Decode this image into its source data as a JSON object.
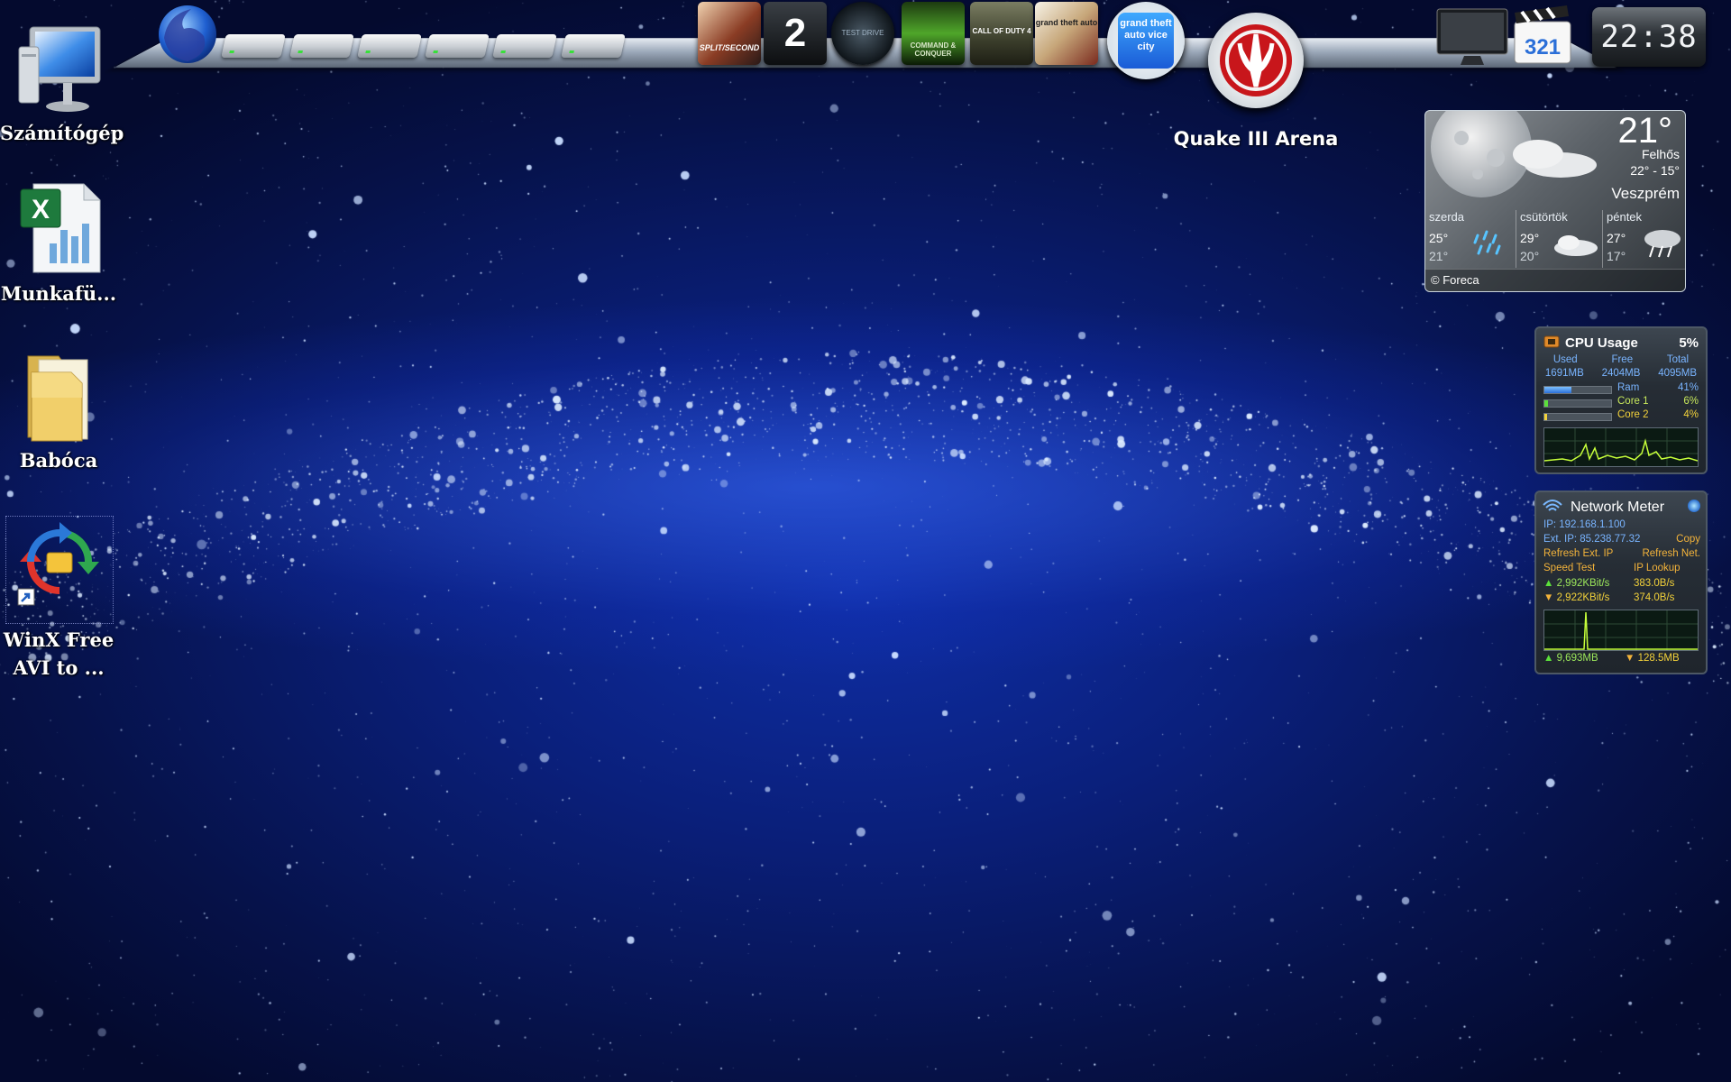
{
  "desktop_icons": [
    {
      "label": "Számítógép"
    },
    {
      "label": "Munkafü..."
    },
    {
      "label": "Babóca"
    },
    {
      "label": "WinX Free\nAVI to ..."
    }
  ],
  "dock": {
    "hovered_label": "Quake III Arena",
    "items": [
      {
        "icon": "firefox-icon"
      },
      {
        "icon": "drive-icon"
      },
      {
        "icon": "drive-icon"
      },
      {
        "icon": "drive-icon"
      },
      {
        "icon": "drive-icon"
      },
      {
        "icon": "drive-icon"
      },
      {
        "icon": "drive-icon"
      },
      {
        "icon": "split-second-icon",
        "text": "SPLIT/SECOND"
      },
      {
        "icon": "portal-2-icon",
        "text": "2"
      },
      {
        "icon": "test-drive-icon",
        "text": "TEST DRIVE"
      },
      {
        "icon": "command-and-conquer-icon",
        "text": "COMMAND & CONQUER"
      },
      {
        "icon": "call-of-duty-4-icon",
        "text": "CALL OF DUTY 4"
      },
      {
        "icon": "gta-san-andreas-icon",
        "text": "grand theft auto"
      },
      {
        "icon": "gta-vice-city-icon",
        "text": "grand theft auto vice city"
      },
      {
        "icon": "quake-3-icon"
      },
      {
        "icon": "monitor-icon"
      },
      {
        "icon": "clapper-321-icon",
        "text": "321"
      }
    ],
    "clock": "22:38"
  },
  "weather": {
    "temp": "21°",
    "condition": "Felhős",
    "range": "22° - 15°",
    "city": "Veszprém",
    "days": [
      {
        "name": "szerda",
        "high": "25°",
        "low": "21°",
        "icon": "rain-icon"
      },
      {
        "name": "csütörtök",
        "high": "29°",
        "low": "20°",
        "icon": "cloud-icon"
      },
      {
        "name": "péntek",
        "high": "27°",
        "low": "17°",
        "icon": "storm-icon"
      }
    ],
    "credit": "© Foreca"
  },
  "cpu": {
    "title": "CPU Usage",
    "percent": "5%",
    "headers": [
      "Used",
      "Free",
      "Total"
    ],
    "values": [
      "1691MB",
      "2404MB",
      "4095MB"
    ],
    "rows": [
      {
        "label": "Ram",
        "value": "41%",
        "fill": 0.41
      },
      {
        "label": "Core 1",
        "value": "6%",
        "fill": 0.06
      },
      {
        "label": "Core 2",
        "value": "4%",
        "fill": 0.04
      }
    ]
  },
  "net": {
    "title": "Network Meter",
    "ip": "IP: 192.168.1.100",
    "ext_ip": "Ext. IP: 85.238.77.32",
    "copy": "Copy",
    "refresh_ext": "Refresh Ext. IP",
    "refresh_net": "Refresh Net.",
    "speed_test": "Speed Test",
    "ip_lookup": "IP Lookup",
    "up_rate": "2,992KBit/s",
    "up_bytes": "383.0B/s",
    "down_rate": "2,922KBit/s",
    "down_bytes": "374.0B/s",
    "total_up": "9,693MB",
    "total_down": "128.5MB"
  },
  "colors": {
    "accent_orange": "#f3b33a",
    "accent_green": "#9de85b",
    "ip_blue": "#79b4ff"
  }
}
